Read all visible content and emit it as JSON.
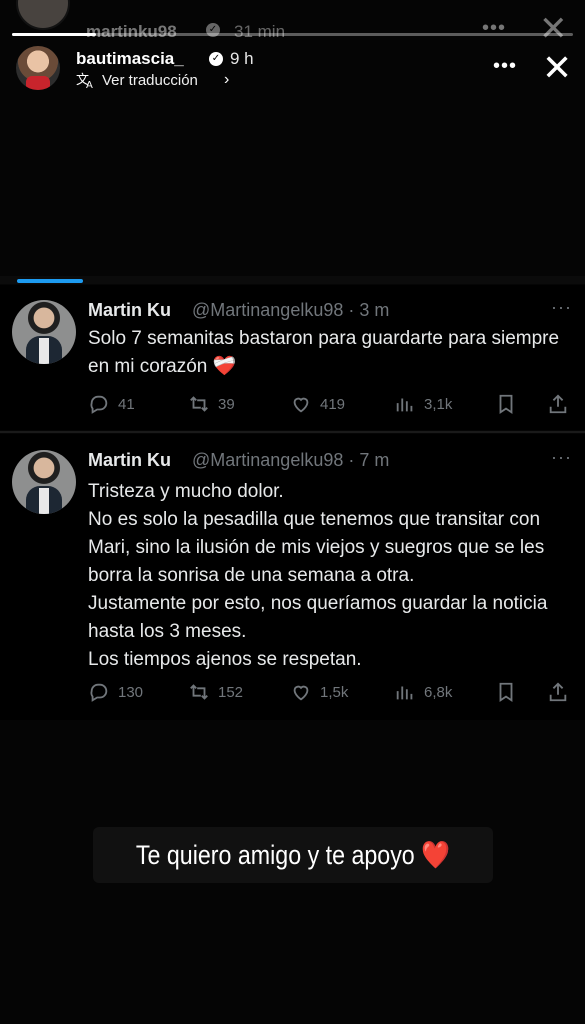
{
  "story_back": {
    "username": "martinku98",
    "time": "31 min"
  },
  "story": {
    "username": "bautimascia_",
    "time": "9 h",
    "translate_label": "Ver traducción",
    "progress": 0.15
  },
  "tweets": [
    {
      "name": "Martin Ku",
      "handle": "@Martinangelku98 · 3 m",
      "text": "Solo 7 semanitas bastaron para guardarte para siempre en mi corazón ❤️‍🩹",
      "replies": "41",
      "retweets": "39",
      "likes": "419",
      "views": "3,1k"
    },
    {
      "name": "Martin Ku",
      "handle": "@Martinangelku98 · 7 m",
      "text": "Tristeza y mucho dolor.\nNo es solo la pesadilla que tenemos que transitar con Mari, sino la ilusión de mis viejos y suegros que se les borra la sonrisa de una semana a otra.\nJustamente por esto, nos queríamos guardar la noticia hasta los 3 meses.\nLos tiempos ajenos se respetan.",
      "replies": "130",
      "retweets": "152",
      "likes": "1,5k",
      "views": "6,8k"
    }
  ],
  "caption": {
    "text": "Te quiero amigo y te apoyo ❤️"
  },
  "colors": {
    "accent": "#1d9bf0",
    "muted": "#71767b",
    "text": "#e7e9ea"
  },
  "icons": [
    "verified-icon",
    "translate-icon",
    "more-icon",
    "close-icon",
    "reply-icon",
    "retweet-icon",
    "like-icon",
    "views-icon",
    "bookmark-icon",
    "share-icon"
  ]
}
